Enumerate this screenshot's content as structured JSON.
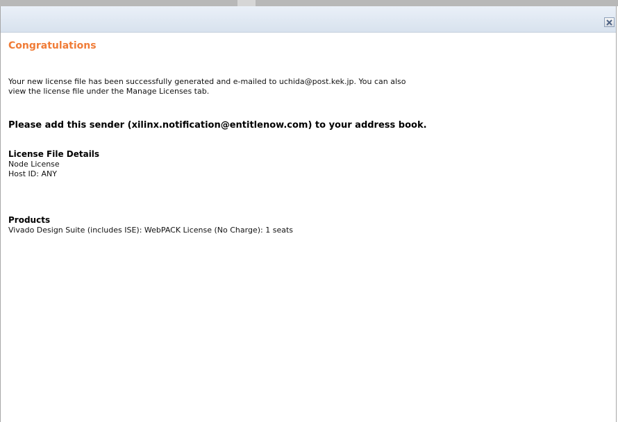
{
  "dialog": {
    "close_symbol": "×",
    "heading": "Congratulations",
    "message_line1": "Your new license file has been successfully generated and e-mailed to uchida@post.kek.jp. You can also",
    "message_line2": "view the license file under the Manage Licenses tab.",
    "sender_notice": "Please add this sender (xilinx.notification@entitlenow.com) to your address book.",
    "license_details": {
      "title": "License File Details",
      "type": "Node License",
      "host_id": "Host ID: ANY"
    },
    "products": {
      "title": "Products",
      "item": "Vivado Design Suite (includes ISE): WebPACK License (No Charge): 1 seats"
    }
  },
  "colors": {
    "heading": "#f07c37",
    "title_bar": "#dfe7f1",
    "close_x": "#5a6d8a"
  },
  "icons": {
    "close": "close-icon"
  }
}
